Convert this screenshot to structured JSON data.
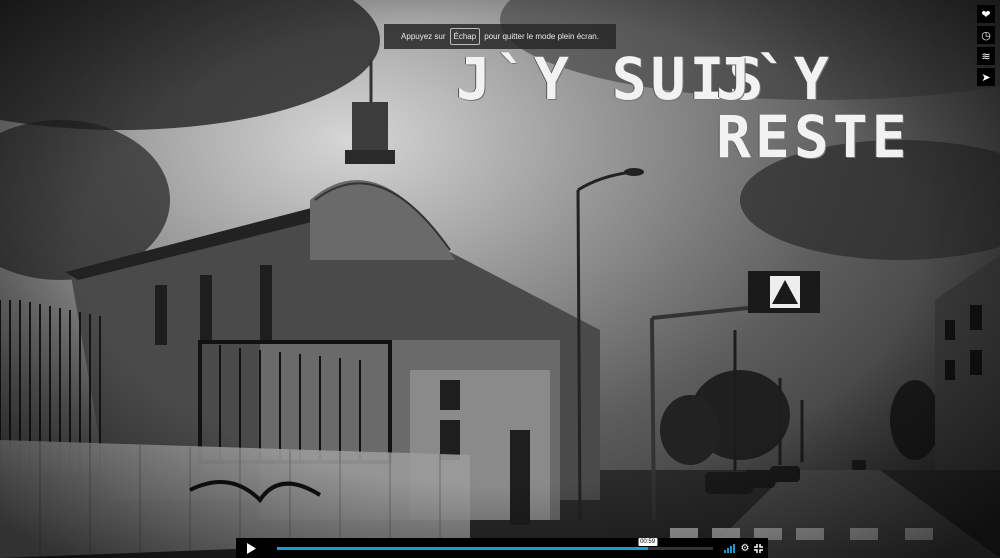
{
  "toast": {
    "before": "Appuyez sur",
    "key": "Échap",
    "after": "pour quitter le mode plein écran."
  },
  "title": {
    "part1": "J`Y SUIS",
    "part2": "J`Y RESTE"
  },
  "side_buttons": [
    {
      "icon": "heart-icon",
      "glyph": "❤"
    },
    {
      "icon": "clock-icon",
      "glyph": "◷"
    },
    {
      "icon": "layers-icon",
      "glyph": "≋"
    },
    {
      "icon": "send-icon",
      "glyph": "➤"
    }
  ],
  "player": {
    "time": "00:59",
    "progress": 0.85,
    "accent": "#1b9bd1"
  }
}
